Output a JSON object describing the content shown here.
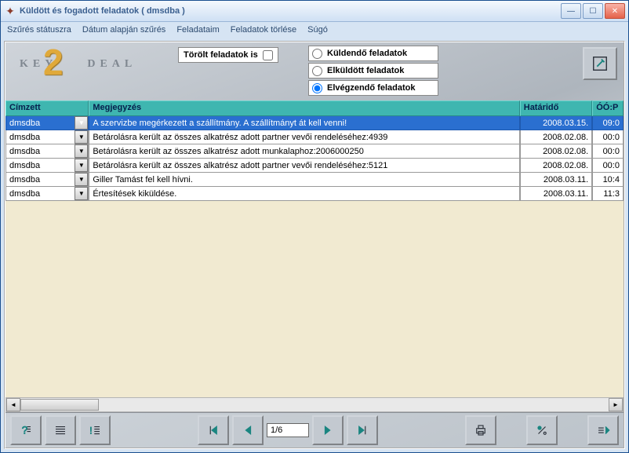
{
  "window": {
    "title": "Küldött és fogadott feladatok ( dmsdba )"
  },
  "menu": {
    "filter_status": "Szűrés státuszra",
    "filter_date": "Dátum alapján szűrés",
    "my_tasks": "Feladataim",
    "delete_tasks": "Feladatok törlése",
    "help": "Súgó"
  },
  "toolbar": {
    "deleted_label": "Törölt feladatok is",
    "radio_to_send": "Küldendő feladatok",
    "radio_sent": "Elküldött feladatok",
    "radio_todo": "Elvégzendő feladatok"
  },
  "columns": {
    "col0": "Címzett",
    "col1": "Megjegyzés",
    "col2": "Határidő",
    "col3": "ÓÓ:P"
  },
  "rows": [
    {
      "to": "dmsdba",
      "note": "A szervizbe megérkezett a szállítmány. A szállítmányt át kell venni!",
      "due": "2008.03.15.",
      "time": "09:0"
    },
    {
      "to": "dmsdba",
      "note": "Betárolásra került az összes alkatrész adott partner vevői rendeléséhez:4939",
      "due": "2008.02.08.",
      "time": "00:0"
    },
    {
      "to": "dmsdba",
      "note": "Betárolásra került az összes alkatrész adott munkalaphoz:2006000250",
      "due": "2008.02.08.",
      "time": "00:0"
    },
    {
      "to": "dmsdba",
      "note": "Betárolásra került az összes alkatrész adott partner vevői rendeléséhez:5121",
      "due": "2008.02.08.",
      "time": "00:0"
    },
    {
      "to": "dmsdba",
      "note": "Giller Tamást fel kell hívni.",
      "due": "2008.03.11.",
      "time": "10:4"
    },
    {
      "to": "dmsdba",
      "note": "Értesítések kiküldése.",
      "due": "2008.03.11.",
      "time": "11:3"
    }
  ],
  "pager": {
    "value": "1/6"
  }
}
